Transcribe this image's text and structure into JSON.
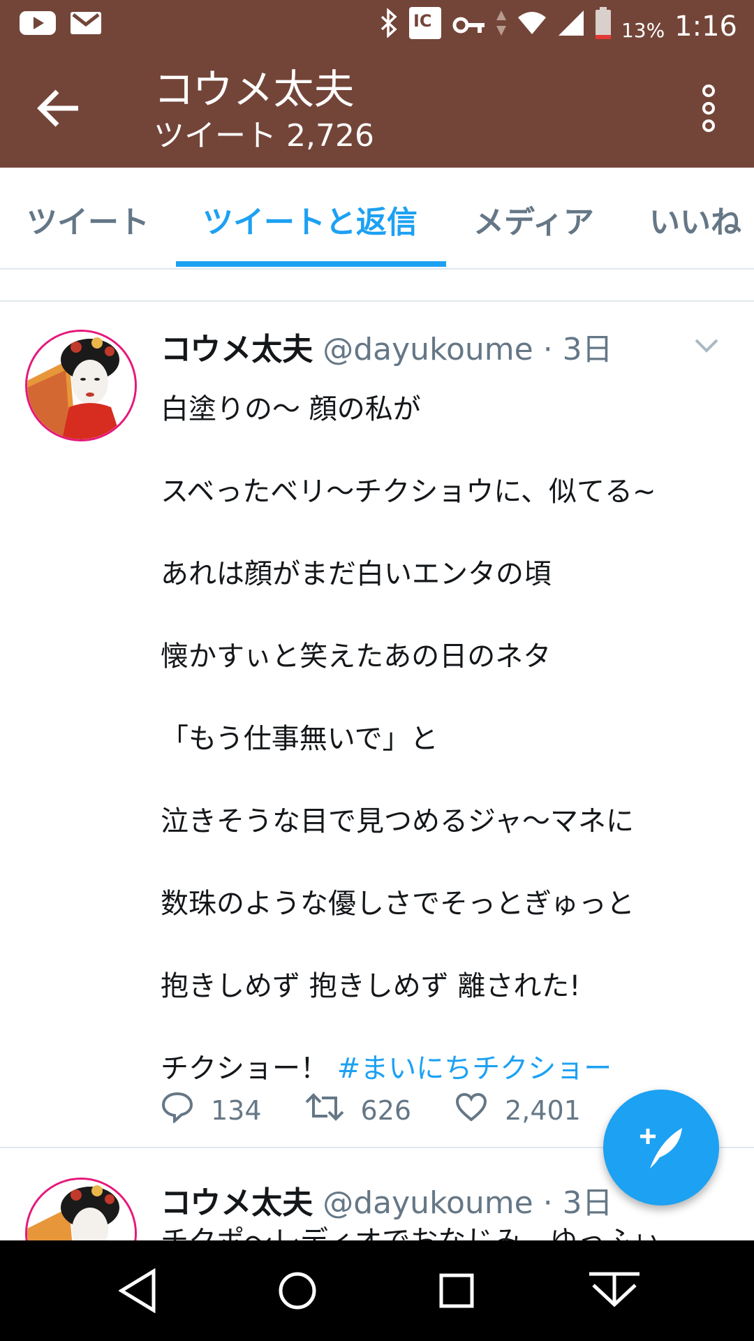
{
  "status_bar": {
    "battery_percent": "13%",
    "time": "1:16"
  },
  "header": {
    "title": "コウメ太夫",
    "subtitle": "ツイート 2,726"
  },
  "tabs": [
    {
      "label": "ツイート",
      "active": false
    },
    {
      "label": "ツイートと返信",
      "active": true
    },
    {
      "label": "メディア",
      "active": false
    },
    {
      "label": "いいね",
      "active": false
    }
  ],
  "tweet": {
    "name": "コウメ太夫",
    "handle": "@dayukoume",
    "time": " · 3日",
    "lines": [
      "白塗りの〜 顔の私が",
      "スベったベリ〜チクショウに、似てる~",
      "あれは顔がまだ白いエンタの頃",
      "懐かすぃと笑えたあの日のネタ",
      "「もう仕事無いで」と",
      "泣きそうな目で見つめるジャ〜マネに",
      "数珠のような優しさでそっとぎゅっと",
      "抱きしめず 抱きしめず 離された!"
    ],
    "last_line_text": "チクショー！ ",
    "hashtag": "#まいにちチクショー",
    "replies": "134",
    "retweets": "626",
    "likes": "2,401"
  },
  "tweet2": {
    "name": "コウメ太夫",
    "handle": "@dayukoume",
    "time": " · 3日",
    "preview": "チクポ〜レディオでおなじみ、ゆっふぃ"
  },
  "colors": {
    "header_bg": "#734538",
    "accent": "#1da1f2",
    "secondary_text": "#657786"
  }
}
